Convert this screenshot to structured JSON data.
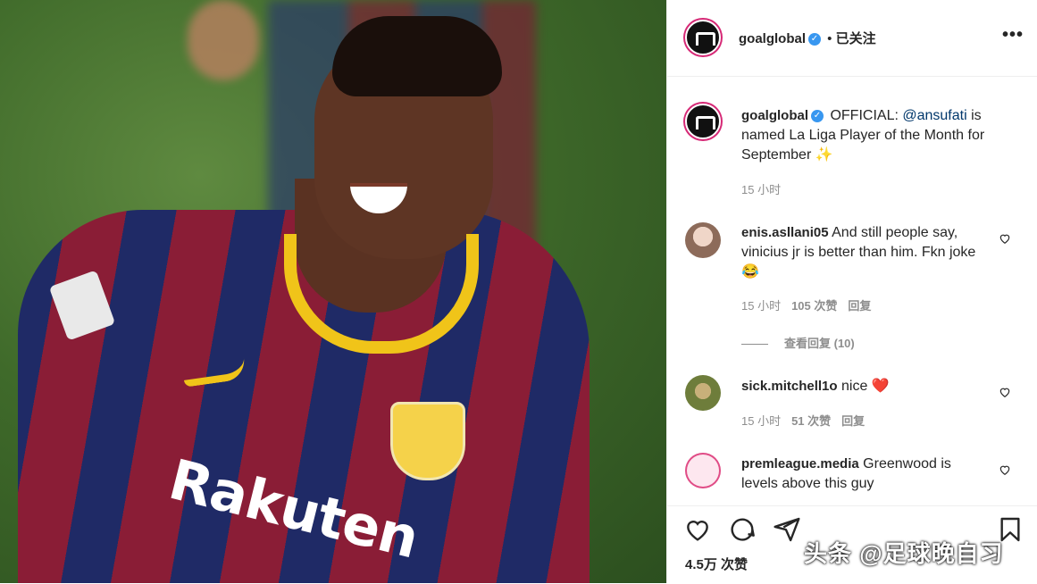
{
  "post": {
    "author": "goalglobal",
    "separator": "•",
    "follow_status": "已关注",
    "more": "•••"
  },
  "photo": {
    "sponsor_text": "Rakuten"
  },
  "caption": {
    "author": "goalglobal",
    "text_before": "OFFICIAL: ",
    "mention": "@ansufati",
    "text_after": " is named La Liga Player of the Month for September",
    "emoji": "✨",
    "time": "15 小时"
  },
  "comments": [
    {
      "user": "enis.asllani05",
      "text": "And still people say, vinicius jr is better than him. Fkn joke 😂",
      "time": "15 小时",
      "likes": "105 次赞",
      "reply": "回复",
      "view_replies": "查看回复 (10)"
    },
    {
      "user": "sick.mitchell1o",
      "text": "nice ❤️",
      "time": "15 小时",
      "likes": "51 次赞",
      "reply": "回复"
    },
    {
      "user": "premleague.media",
      "text": "Greenwood is levels above this guy"
    }
  ],
  "actions": {
    "likes": "4.5万 次赞"
  },
  "watermark": "头条 @足球晚自习",
  "colors": {
    "verified": "#3897f0",
    "mention": "#00376b",
    "muted": "#8e8e8e",
    "heart": "#ed4956"
  }
}
